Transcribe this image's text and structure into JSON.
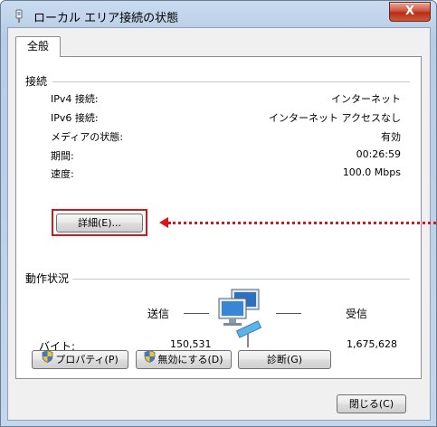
{
  "window": {
    "title": "ローカル エリア接続の状態",
    "close_label": "X"
  },
  "tabs": [
    "全般"
  ],
  "connection": {
    "group_title": "接続",
    "rows": [
      {
        "label": "IPv4 接続:",
        "value": "インターネット"
      },
      {
        "label": "IPv6 接続:",
        "value": "インターネット アクセスなし"
      },
      {
        "label": "メディアの状態:",
        "value": "有効"
      },
      {
        "label": "期間:",
        "value": "00:26:59"
      },
      {
        "label": "速度:",
        "value": "100.0 Mbps"
      }
    ],
    "details_button": "詳細(E)..."
  },
  "activity": {
    "group_title": "動作状況",
    "sent_label": "送信",
    "received_label": "受信",
    "bytes_label": "バイト:",
    "bytes_sent": "150,531",
    "bytes_received": "1,675,628"
  },
  "buttons": {
    "properties": "プロパティ(P)",
    "disable": "無効にする(D)",
    "diagnose": "診断(G)",
    "close": "閉じる(C)"
  },
  "colors": {
    "highlight": "#d8151c",
    "title_gradient": "#c9dbef",
    "close_button": "#c8442c"
  }
}
